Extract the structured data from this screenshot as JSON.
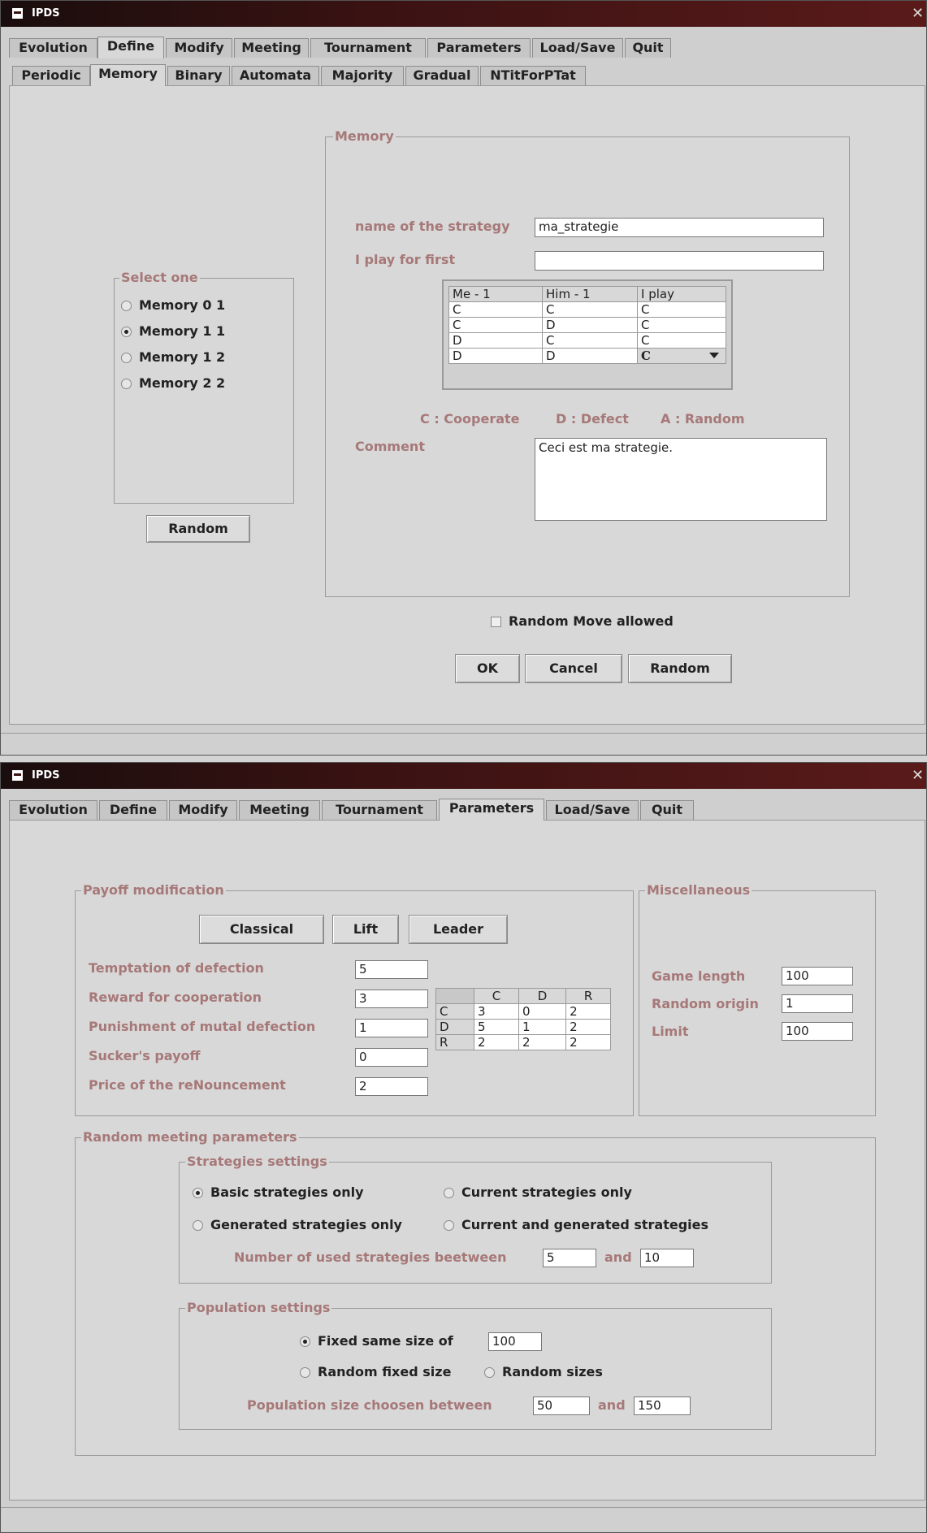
{
  "window1": {
    "title": "IPDS",
    "close": "✕",
    "tabs": [
      "Evolution",
      "Define",
      "Modify",
      "Meeting",
      "Tournament",
      "Parameters",
      "Load/Save",
      "Quit"
    ],
    "subtabs": [
      "Periodic",
      "Memory",
      "Binary",
      "Automata",
      "Majority",
      "Gradual",
      "NTitForPTat"
    ],
    "select_group": {
      "legend": "Select one",
      "options": [
        "Memory 0 1",
        "Memory 1 1",
        "Memory 1 2",
        "Memory 2 2"
      ],
      "selected_index": 1,
      "random_button": "Random"
    },
    "memory_group": {
      "legend": "Memory",
      "name_label": "name of the strategy",
      "name_value": "ma_strategie",
      "first_label": "I play for first",
      "first_value": "",
      "table_headers": [
        "Me - 1",
        "Him - 1",
        "I play"
      ],
      "table_rows": [
        [
          "C",
          "C",
          "C"
        ],
        [
          "C",
          "D",
          "C"
        ],
        [
          "D",
          "C",
          "C"
        ],
        [
          "D",
          "D",
          "C"
        ]
      ],
      "legend_c": "C : Cooperate",
      "legend_d": "D : Defect",
      "legend_a": "A : Random",
      "comment_label": "Comment",
      "comment_value": "Ceci est ma strategie."
    },
    "random_move_label": "Random Move allowed",
    "random_move_checked": false,
    "buttons": {
      "ok": "OK",
      "cancel": "Cancel",
      "random": "Random"
    }
  },
  "window2": {
    "title": "IPDS",
    "close": "✕",
    "tabs": [
      "Evolution",
      "Define",
      "Modify",
      "Meeting",
      "Tournament",
      "Parameters",
      "Load/Save",
      "Quit"
    ],
    "payoff": {
      "legend": "Payoff modification",
      "presets": [
        "Classical",
        "Lift",
        "Leader"
      ],
      "params": [
        {
          "label": "Temptation of defection",
          "value": "5"
        },
        {
          "label": "Reward for cooperation",
          "value": "3"
        },
        {
          "label": "Punishment of mutal defection",
          "value": "1"
        },
        {
          "label": "Sucker's payoff",
          "value": "0"
        },
        {
          "label": "Price of the reNouncement",
          "value": "2"
        }
      ],
      "matrix_headers": [
        "",
        "C",
        "D",
        "R"
      ],
      "matrix_rows": [
        [
          "C",
          "3",
          "0",
          "2"
        ],
        [
          "D",
          "5",
          "1",
          "2"
        ],
        [
          "R",
          "2",
          "2",
          "2"
        ]
      ]
    },
    "misc": {
      "legend": "Miscellaneous",
      "fields": [
        {
          "label": "Game length",
          "value": "100"
        },
        {
          "label": "Random origin",
          "value": "1"
        },
        {
          "label": "Limit",
          "value": "100"
        }
      ]
    },
    "random_meeting": {
      "legend": "Random meeting parameters",
      "strategies": {
        "legend": "Strategies settings",
        "options": [
          "Basic strategies only",
          "Current strategies only",
          "Generated strategies only",
          "Current and generated strategies"
        ],
        "selected_index": 0,
        "range_label": "Number of used strategies beetween",
        "range_and": "and",
        "range_min": "5",
        "range_max": "10"
      },
      "population": {
        "legend": "Population settings",
        "fixed_label": "Fixed same size of",
        "fixed_value": "100",
        "random_fixed_label": "Random fixed size",
        "random_sizes_label": "Random sizes",
        "selected": "fixed",
        "range_label": "Population size choosen between",
        "range_and": "and",
        "range_min": "50",
        "range_max": "150"
      }
    }
  }
}
